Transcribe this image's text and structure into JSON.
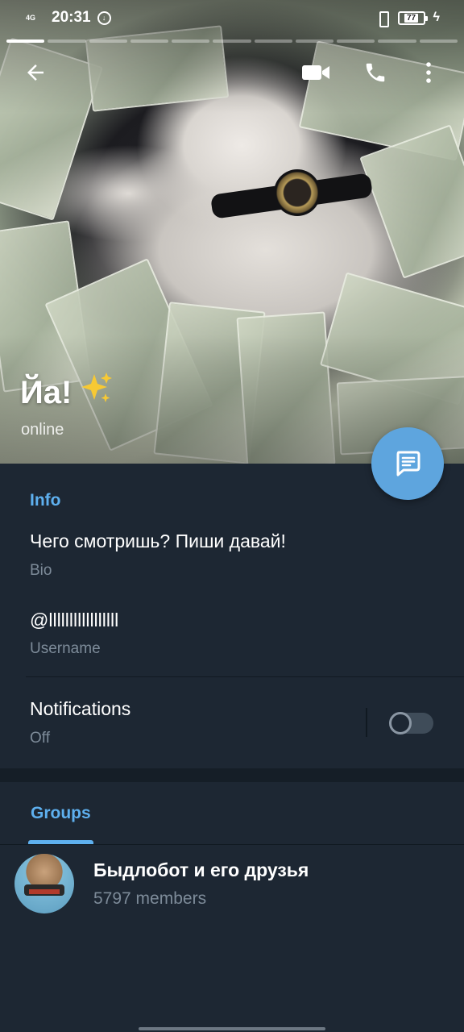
{
  "status_bar": {
    "network": "4G",
    "time": "20:31",
    "battery": "77"
  },
  "profile": {
    "name": "Йа!",
    "name_emoji": "✨",
    "status": "online"
  },
  "toolbar": {
    "back_icon": "arrow-left-icon",
    "video_icon": "video-camera-icon",
    "call_icon": "phone-icon",
    "more_icon": "more-vertical-icon"
  },
  "story": {
    "segments": 11,
    "active": 1
  },
  "info": {
    "section_title": "Info",
    "bio": {
      "value": "Чего смотришь? Пиши давай!",
      "label": "Bio"
    },
    "username": {
      "value": "@lllllllllllllllll",
      "label": "Username"
    },
    "notifications": {
      "title": "Notifications",
      "state": "Off",
      "enabled": false
    }
  },
  "groups": {
    "tab_label": "Groups",
    "items": [
      {
        "name": "Быдлобот и его друзья",
        "members": "5797 members"
      }
    ]
  },
  "colors": {
    "accent": "#5eb0ef",
    "fab": "#5ea5de",
    "background": "#1d2733",
    "secondary_text": "#7d8b99"
  }
}
